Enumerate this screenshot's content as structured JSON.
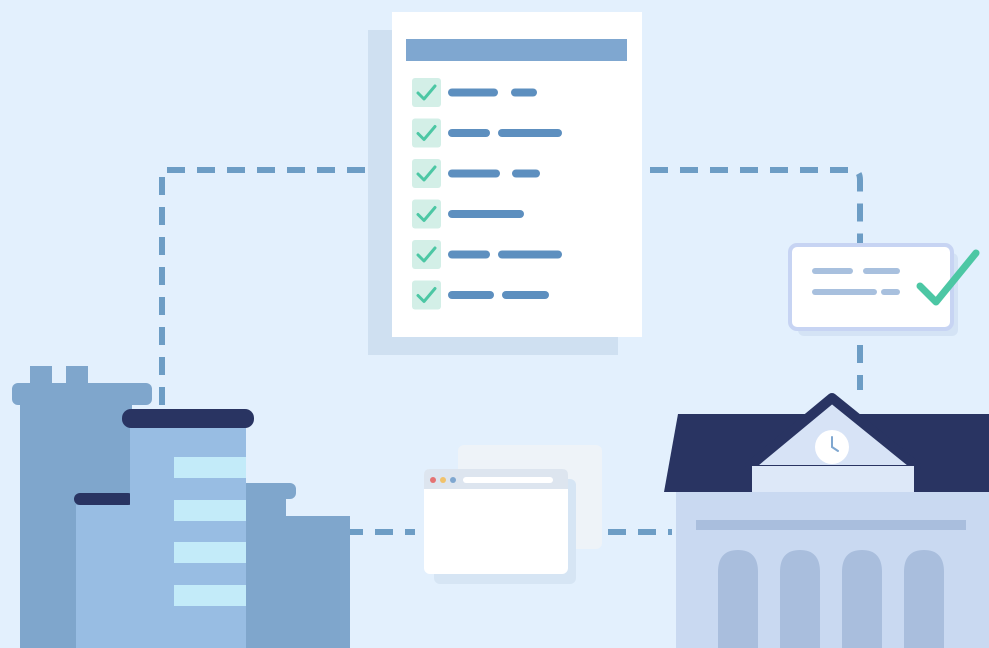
{
  "colors": {
    "background": "#e3f0fd",
    "connector": "#6d9dc5",
    "check_green": "#4cc7a4",
    "check_box": "#d3efe7",
    "doc_header": "#7fa7d0",
    "doc_line": "#5d8fbf",
    "building_dark": "#7fa6cc",
    "building_light": "#98bde3",
    "building_window": "#c3ebf9",
    "roof_navy": "#293462",
    "museum_body": "#c9d9f1",
    "museum_column": "#a9bedd"
  },
  "illustration": {
    "checklist_items": 6,
    "icons": [
      "checklist-document-icon",
      "verified-card-icon",
      "office-building-icon",
      "browser-window-icon",
      "government-building-icon",
      "clock-icon"
    ]
  }
}
